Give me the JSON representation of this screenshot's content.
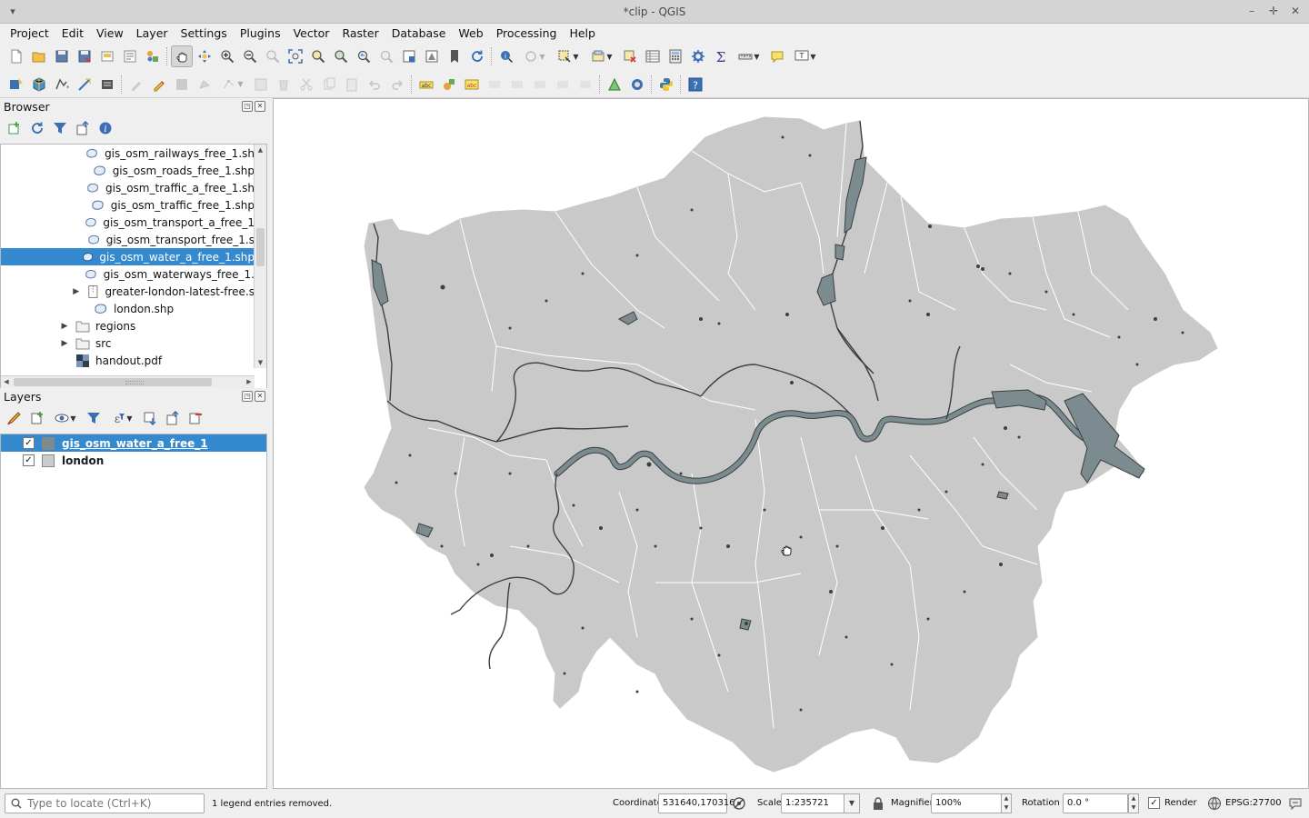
{
  "window": {
    "title": "*clip - QGIS"
  },
  "menubar": {
    "items": [
      "Project",
      "Edit",
      "View",
      "Layer",
      "Settings",
      "Plugins",
      "Vector",
      "Raster",
      "Database",
      "Web",
      "Processing",
      "Help"
    ]
  },
  "browser": {
    "title": "Browser",
    "items": [
      {
        "label": "gis_osm_railways_free_1.sh",
        "icon": "vector-layer-icon",
        "selected": false
      },
      {
        "label": "gis_osm_roads_free_1.shp",
        "icon": "vector-layer-icon",
        "selected": false
      },
      {
        "label": "gis_osm_traffic_a_free_1.sh",
        "icon": "vector-layer-icon",
        "selected": false
      },
      {
        "label": "gis_osm_traffic_free_1.shp",
        "icon": "vector-layer-icon",
        "selected": false
      },
      {
        "label": "gis_osm_transport_a_free_1",
        "icon": "vector-layer-icon",
        "selected": false
      },
      {
        "label": "gis_osm_transport_free_1.s",
        "icon": "vector-layer-icon",
        "selected": false
      },
      {
        "label": "gis_osm_water_a_free_1.shp",
        "icon": "vector-layer-icon",
        "selected": true
      },
      {
        "label": "gis_osm_waterways_free_1.",
        "icon": "vector-layer-icon",
        "selected": false
      },
      {
        "label": "greater-london-latest-free.s",
        "icon": "zip-archive-icon",
        "selected": false
      },
      {
        "label": "london.shp",
        "icon": "vector-layer-icon",
        "selected": false
      },
      {
        "label": "regions",
        "icon": "folder-icon",
        "selected": false
      },
      {
        "label": "src",
        "icon": "folder-icon",
        "selected": false
      },
      {
        "label": "handout.pdf",
        "icon": "pdf-file-icon",
        "selected": false
      }
    ]
  },
  "layers": {
    "title": "Layers",
    "items": [
      {
        "label": "gis_osm_water_a_free_1",
        "checked": true,
        "selected": true,
        "swatch": "#7b8b8f"
      },
      {
        "label": "london",
        "checked": true,
        "selected": false,
        "swatch": "#cccccc"
      }
    ]
  },
  "map": {
    "land_color": "#c9c9c9",
    "water_color": "#7b8b8f",
    "boundary_color": "#ffffff"
  },
  "status": {
    "locator_placeholder": "Type to locate (Ctrl+K)",
    "message": "1 legend entries removed.",
    "coordinate_label": "Coordinate",
    "coordinate_value": "531640,170316",
    "scale_label": "Scale",
    "scale_value": "1:235721",
    "magnifier_label": "Magnifier",
    "magnifier_value": "100%",
    "rotation_label": "Rotation",
    "rotation_value": "0.0 °",
    "render_label": "Render",
    "render_checked": true,
    "crs": "EPSG:27700"
  }
}
